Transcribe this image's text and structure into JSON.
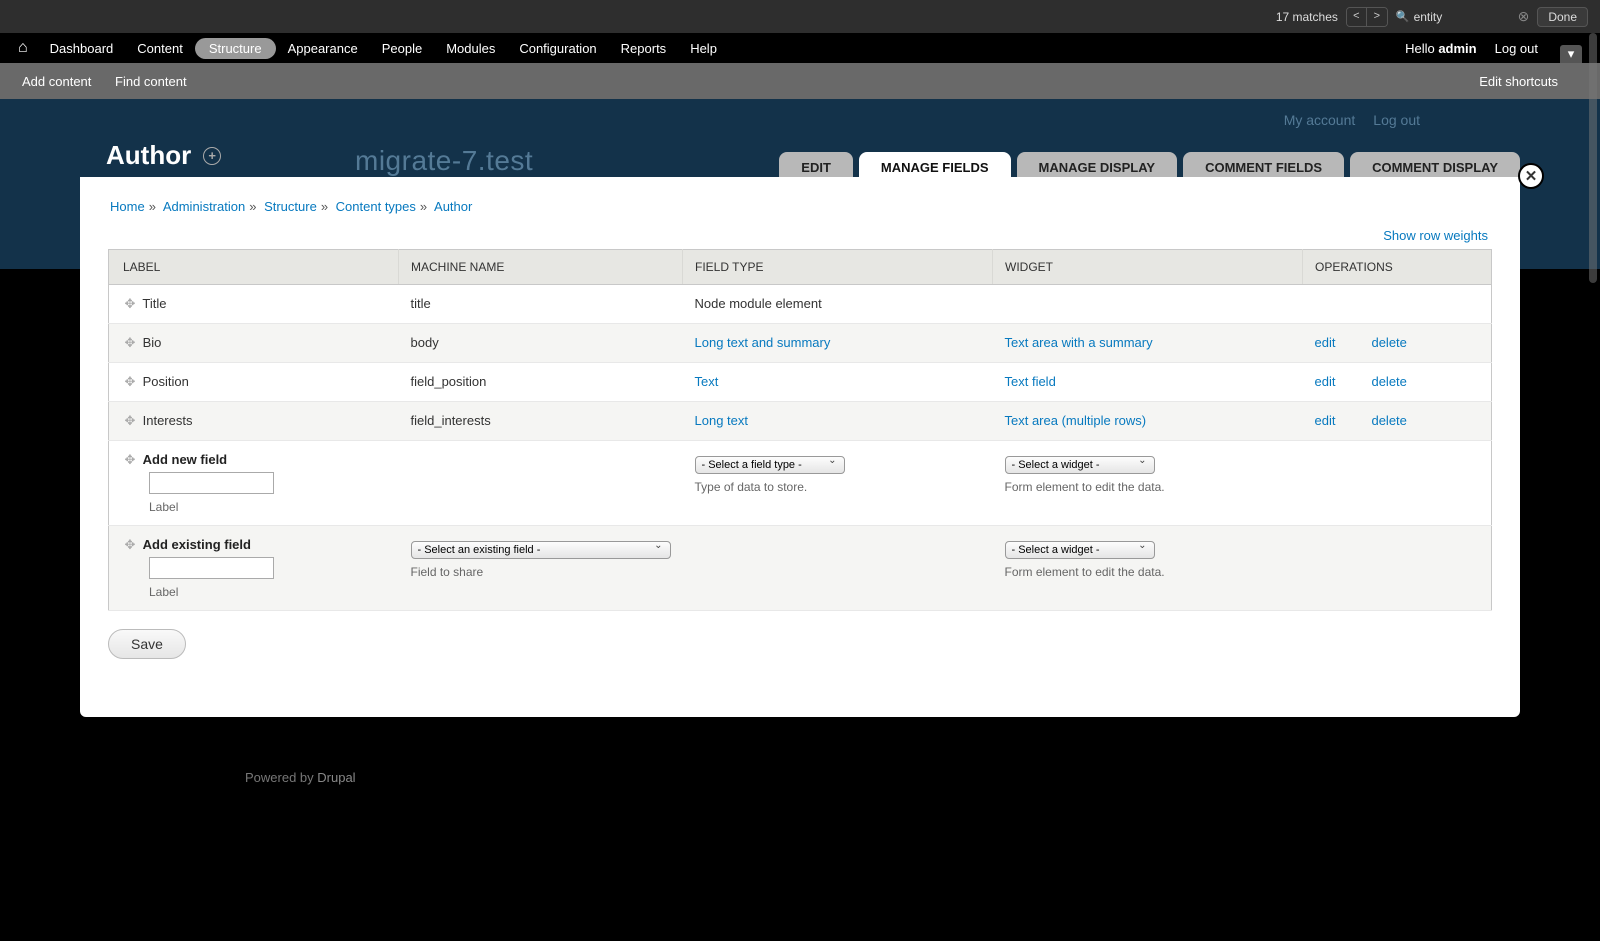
{
  "findbar": {
    "matches": "17 matches",
    "query": "entity",
    "done": "Done"
  },
  "toolbar": {
    "items": [
      "Dashboard",
      "Content",
      "Structure",
      "Appearance",
      "People",
      "Modules",
      "Configuration",
      "Reports",
      "Help"
    ],
    "active_index": 2,
    "hello": "Hello ",
    "user": "admin",
    "logout": "Log out"
  },
  "shortcuts": {
    "add": "Add content",
    "find": "Find content",
    "edit": "Edit shortcuts"
  },
  "background": {
    "site_name": "migrate-7.test",
    "my_account": "My account",
    "logout": "Log out",
    "footer_prefix": "Powered by ",
    "footer_link": "Drupal"
  },
  "overlay": {
    "title": "Author",
    "tabs": [
      "EDIT",
      "MANAGE FIELDS",
      "MANAGE DISPLAY",
      "COMMENT FIELDS",
      "COMMENT DISPLAY"
    ],
    "active_tab": 1,
    "breadcrumb": [
      "Home",
      "Administration",
      "Structure",
      "Content types",
      "Author"
    ],
    "show_row_weights": "Show row weights",
    "headers": {
      "label": "LABEL",
      "machine": "MACHINE NAME",
      "type": "FIELD TYPE",
      "widget": "WIDGET",
      "ops": "OPERATIONS"
    },
    "rows": [
      {
        "label": "Title",
        "machine": "title",
        "type": "Node module element",
        "type_link": false,
        "widget": "",
        "widget_link": false,
        "ops": false
      },
      {
        "label": "Bio",
        "machine": "body",
        "type": "Long text and summary",
        "type_link": true,
        "widget": "Text area with a summary",
        "widget_link": true,
        "ops": true
      },
      {
        "label": "Position",
        "machine": "field_position",
        "type": "Text",
        "type_link": true,
        "widget": "Text field",
        "widget_link": true,
        "ops": true
      },
      {
        "label": "Interests",
        "machine": "field_interests",
        "type": "Long text",
        "type_link": true,
        "widget": "Text area (multiple rows)",
        "widget_link": true,
        "ops": true
      }
    ],
    "op_edit": "edit",
    "op_delete": "delete",
    "add_new": {
      "title": "Add new field",
      "label_help": "Label",
      "type_select": "- Select a field type -",
      "type_help": "Type of data to store.",
      "widget_select": "- Select a widget -",
      "widget_help": "Form element to edit the data."
    },
    "add_existing": {
      "title": "Add existing field",
      "label_help": "Label",
      "field_select": "- Select an existing field -",
      "field_help": "Field to share",
      "widget_select": "- Select a widget -",
      "widget_help": "Form element to edit the data."
    },
    "save": "Save"
  }
}
